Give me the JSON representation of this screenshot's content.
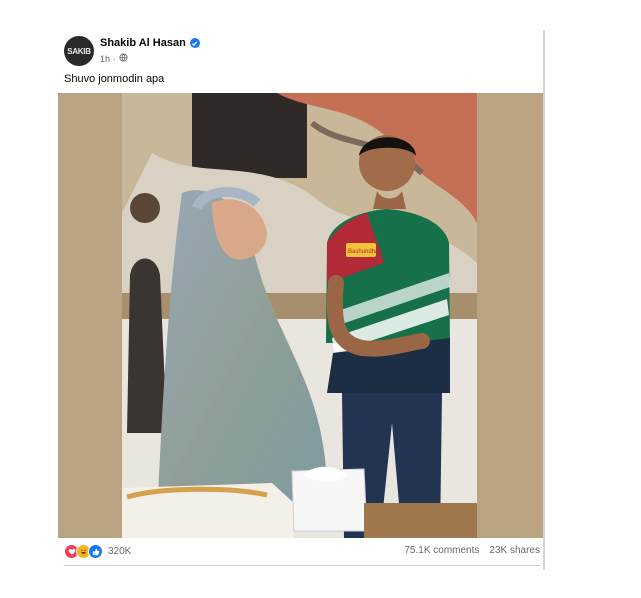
{
  "post": {
    "author": "Shakib Al Hasan",
    "avatar_text": "SAKIB",
    "time": "1h",
    "separator": "·",
    "privacy_icon": "globe-icon",
    "verified_icon": "verified-badge-icon",
    "caption": "Shuvo jonmodin apa"
  },
  "photo": {
    "jersey_patch": "Bashundhara",
    "icon": "post-photo"
  },
  "footer": {
    "reactions": [
      "love-reaction-icon",
      "haha-reaction-icon",
      "like-reaction-icon"
    ],
    "reaction_count": "320K",
    "comments": "75.1K comments",
    "shares": "23K shares"
  },
  "colors": {
    "brand_blue": "#1877f2",
    "muted_text": "#65676b",
    "photo_background": "#b9a383"
  }
}
